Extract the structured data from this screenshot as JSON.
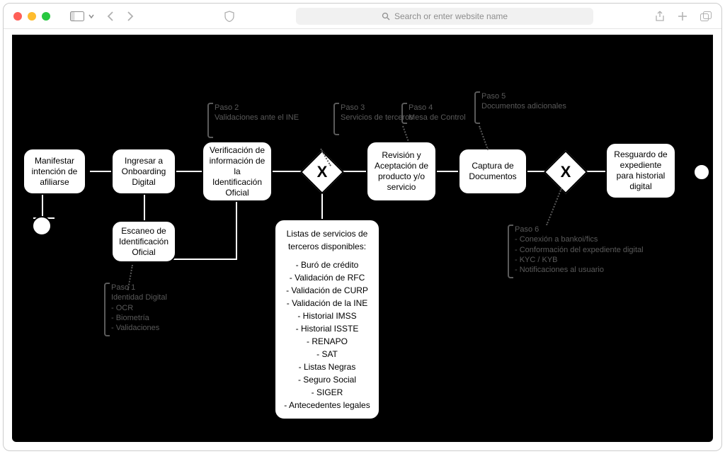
{
  "browser": {
    "search_placeholder": "Search or enter website name"
  },
  "nodes": {
    "manifestar": "Manifestar intención de afiliarse",
    "ingresar": "Ingresar a Onboarding Digital",
    "escaneo": "Escaneo de Identificación Oficial",
    "verificacion": "Verificación de información de la Identificación Oficial",
    "revision": "Revisión y Aceptación de producto y/o servicio",
    "captura": "Captura de Documentos",
    "resguardo": "Resguardo de expediente para historial digital"
  },
  "services": {
    "title": "Listas de servicios de terceros disponibles:",
    "items": "- Buró de crédito\n- Validación de RFC\n- Validación de CURP\n- Validación de la INE\n- Historial IMSS\n- Historial ISSTE\n- RENAPO\n- SAT\n- Listas Negras\n- Seguro Social\n- SIGER\n- Antecedentes legales"
  },
  "annotations": {
    "p1": "Paso 1\nIdentidad Digital\n- OCR\n- Biometría\n- Validaciones",
    "p2": "Paso 2\nValidaciones ante el INE",
    "p3": "Paso 3\nServicios de terceros",
    "p4": "Paso 4\nMesa de Control",
    "p5": "Paso 5\nDocumentos adicionales",
    "p6": "Paso 6\n- Conexión a bankoi/fics\n- Conformación del expediente digital\n- KYC / KYB\n- Notificaciones al usuario"
  }
}
